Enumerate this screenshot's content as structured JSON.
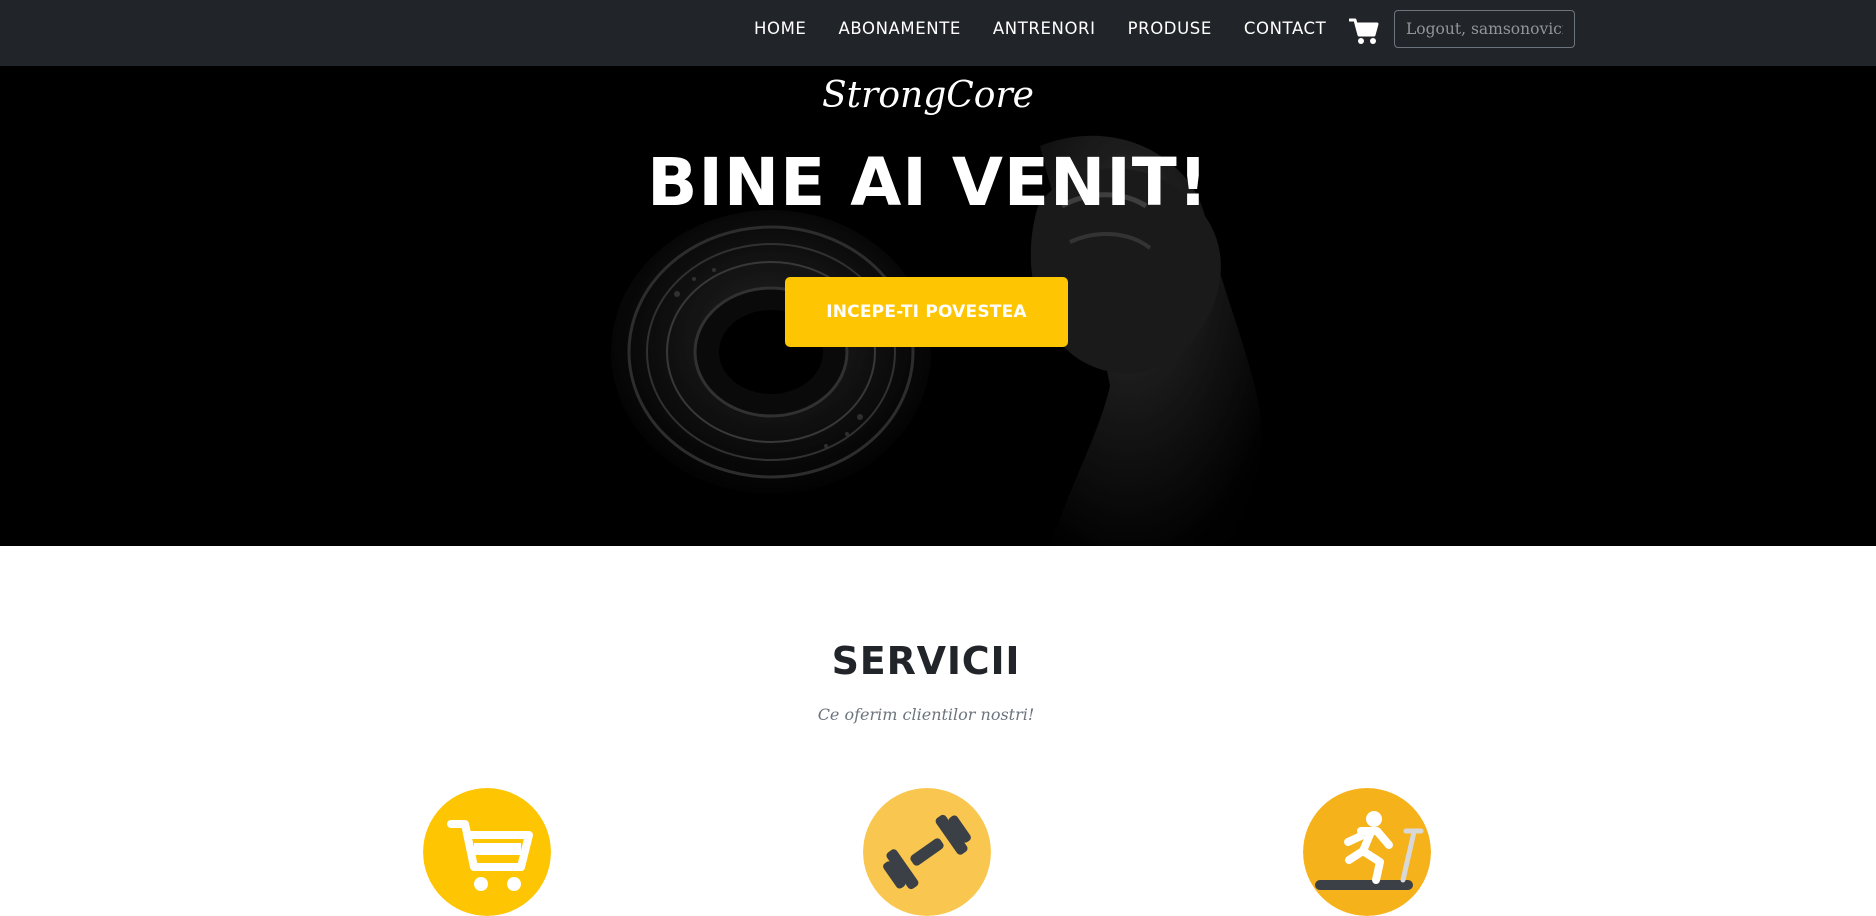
{
  "nav": {
    "links": [
      "HOME",
      "ABONAMENTE",
      "ANTRENORI",
      "PRODUSE",
      "CONTACT"
    ],
    "cart_icon": "shopping-cart-icon",
    "logout_placeholder": "Logout, samsonovici"
  },
  "hero": {
    "brand": "StrongCore",
    "title": "BINE AI VENIT!",
    "button_label": "INCEPE-TI POVESTEA"
  },
  "services": {
    "title": "SERVICII",
    "subtitle": "Ce oferim clientilor nostri!",
    "items": [
      {
        "icon": "shopping-cart-icon",
        "color": "#fec503"
      },
      {
        "icon": "dumbbell-icon",
        "color": "#f9c74f"
      },
      {
        "icon": "treadmill-runner-icon",
        "color": "#f6b21b"
      }
    ]
  },
  "colors": {
    "navbar": "#212529",
    "accent": "#fec503",
    "text_dark": "#212529",
    "text_muted": "#6c757d"
  }
}
